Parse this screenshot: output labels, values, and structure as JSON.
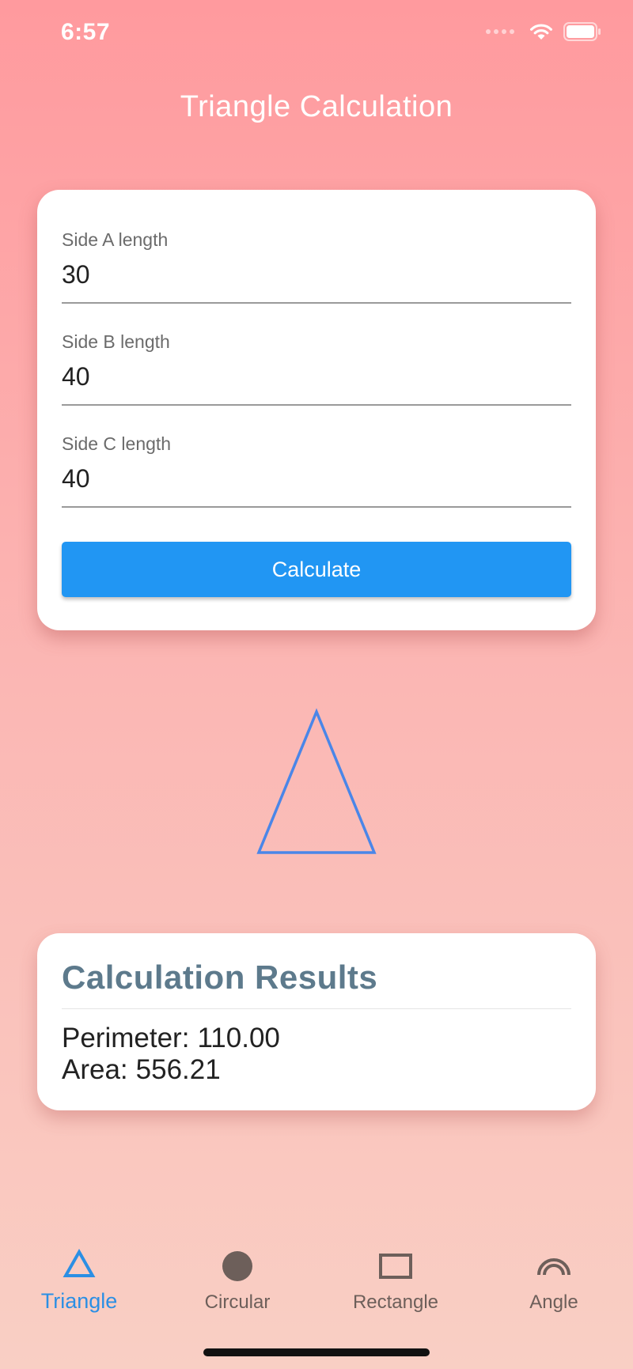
{
  "status_bar": {
    "time": "6:57"
  },
  "header": {
    "title": "Triangle Calculation"
  },
  "form": {
    "fields": [
      {
        "label": "Side A length",
        "value": "30"
      },
      {
        "label": "Side B length",
        "value": "40"
      },
      {
        "label": "Side C length",
        "value": "40"
      }
    ],
    "calculate_label": "Calculate"
  },
  "results": {
    "title": "Calculation Results",
    "perimeter_label": "Perimeter:",
    "perimeter_value": "110.00",
    "area_label": "Area:",
    "area_value": "556.21"
  },
  "bottom_nav": {
    "items": [
      {
        "label": "Triangle",
        "icon": "triangle-icon",
        "active": true
      },
      {
        "label": "Circular",
        "icon": "circle-icon",
        "active": false
      },
      {
        "label": "Rectangle",
        "icon": "rectangle-icon",
        "active": false
      },
      {
        "label": "Angle",
        "icon": "angle-arc-icon",
        "active": false
      }
    ]
  },
  "colors": {
    "background_top": "#ff9a9e",
    "background_bottom": "#f9cfc4",
    "accent_blue": "#2196f3",
    "active_nav": "#2b8fe4",
    "inactive_nav": "#6d5f5a",
    "results_title": "#5d7a8c",
    "triangle_stroke": "#4a86e8"
  }
}
